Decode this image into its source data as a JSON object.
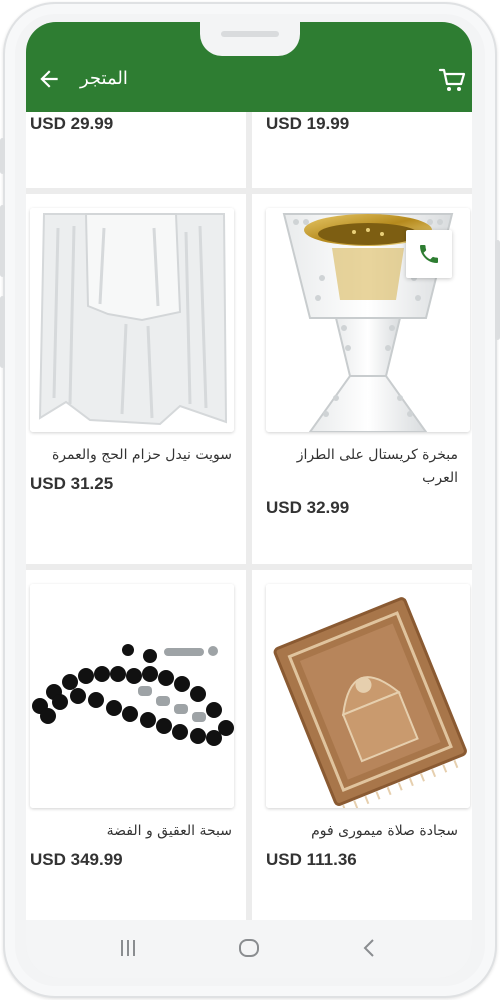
{
  "header": {
    "title": "المتجر",
    "color": "#2e7d32",
    "back_icon": "arrow-left-icon",
    "cart_icon": "shopping-cart-icon"
  },
  "products": [
    {
      "name": "",
      "price": "USD 19.99"
    },
    {
      "name": "",
      "price": "USD 29.99"
    },
    {
      "name": "مبخرة كريستال على الطراز العرب",
      "price": "USD 32.99"
    },
    {
      "name": "سويت نيدل حزام الحج والعمرة",
      "price": "USD 31.25"
    },
    {
      "name": "سجادة صلاة ميمورى فوم",
      "price": "USD 111.36"
    },
    {
      "name": "سبحة العقيق و الفضة",
      "price": "USD 349.99"
    }
  ],
  "call_button": {
    "icon": "phone-icon",
    "color": "#2e7d32"
  },
  "nav": {
    "icons": [
      "recent-apps-icon",
      "home-icon",
      "back-icon"
    ]
  }
}
